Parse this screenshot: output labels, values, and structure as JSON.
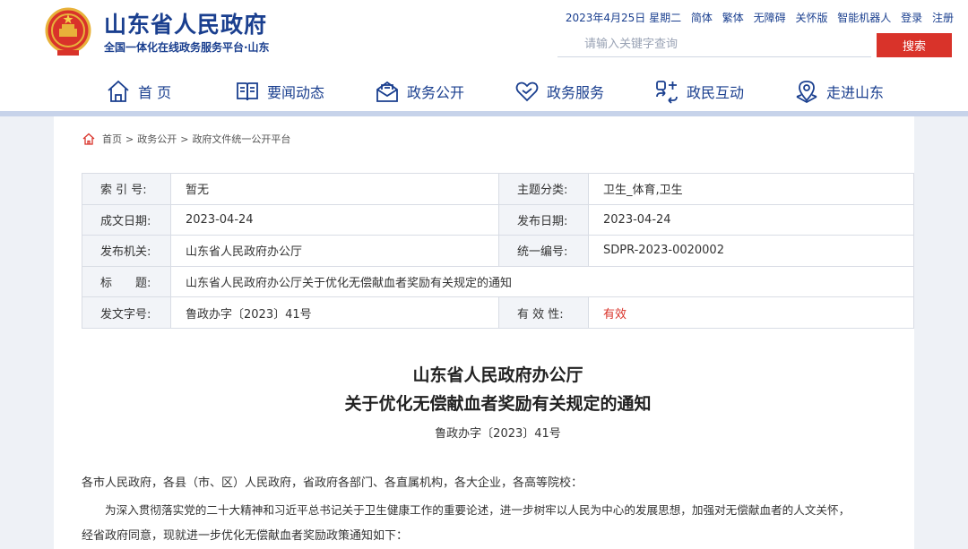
{
  "header": {
    "site_title": "山东省人民政府",
    "site_subtitle": "全国一体化在线政务服务平台·山东",
    "date": "2023年4月25日 星期二",
    "links": [
      "简体",
      "繁体",
      "无障碍",
      "关怀版",
      "智能机器人",
      "登录",
      "注册"
    ],
    "search_placeholder": "请输入关键字查询",
    "search_label": "搜索"
  },
  "nav": [
    {
      "label": "首 页",
      "icon": "home-icon"
    },
    {
      "label": "要闻动态",
      "icon": "news-icon"
    },
    {
      "label": "政务公开",
      "icon": "mail-open-icon"
    },
    {
      "label": "政务服务",
      "icon": "heart-hand-icon"
    },
    {
      "label": "政民互动",
      "icon": "interaction-icon"
    },
    {
      "label": "走进山东",
      "icon": "location-icon"
    }
  ],
  "breadcrumb": [
    "首页",
    "政务公开",
    "政府文件统一公开平台"
  ],
  "meta": {
    "index_label": "索 引 号:",
    "index_value": "暂无",
    "topic_label": "主题分类:",
    "topic_value": "卫生_体育,卫生",
    "created_label": "成文日期:",
    "created_value": "2023-04-24",
    "published_label": "发布日期:",
    "published_value": "2023-04-24",
    "org_label": "发布机关:",
    "org_value": "山东省人民政府办公厅",
    "unified_label": "统一编号:",
    "unified_value": "SDPR-2023-0020002",
    "title_label": "标　　题:",
    "title_value": "山东省人民政府办公厅关于优化无偿献血者奖励有关规定的通知",
    "docno_label": "发文字号:",
    "docno_value": "鲁政办字〔2023〕41号",
    "validity_label": "有 效 性:",
    "validity_value": "有效",
    "validity_color": "#d9332a"
  },
  "document": {
    "title_line1": "山东省人民政府办公厅",
    "title_line2": "关于优化无偿献血者奖励有关规定的通知",
    "doc_number": "鲁政办字〔2023〕41号",
    "salutation": "各市人民政府，各县（市、区）人民政府，省政府各部门、各直属机构，各大企业，各高等院校：",
    "para1_line1": "为深入贯彻落实党的二十大精神和习近平总书记关于卫生健康工作的重要论述，进一步树牢以人民为中心的发展思想，加强对无偿献血者的人文关怀，",
    "para1_line2": "经省政府同意，现就进一步优化无偿献血者奖励政策通知如下："
  },
  "colors": {
    "brand_blue": "#1a3f8f",
    "search_red": "#d9332a",
    "nav_bar": "#c7d3ea"
  }
}
